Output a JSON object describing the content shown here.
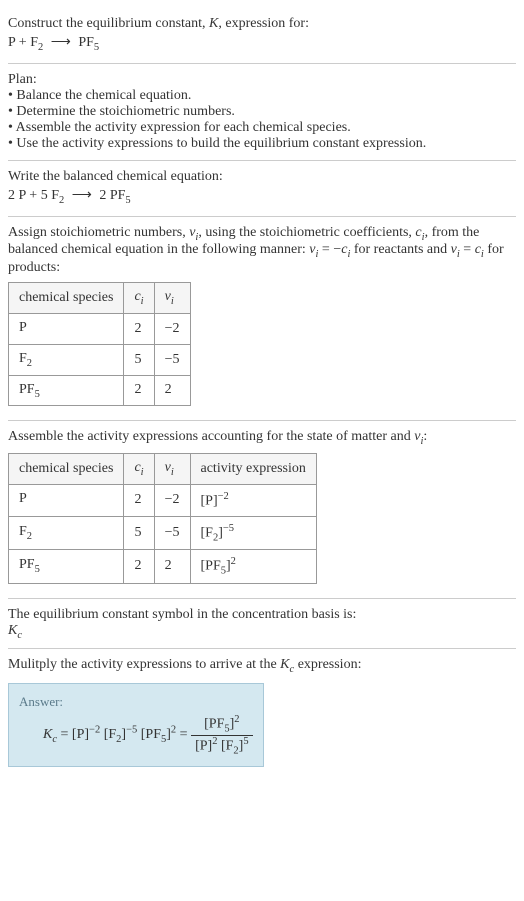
{
  "intro": {
    "line1_pre": "Construct the equilibrium constant, ",
    "line1_k": "K",
    "line1_post": ", expression for:",
    "reaction_lhs_1": "P",
    "reaction_plus": " + ",
    "reaction_lhs_2": "F",
    "reaction_lhs_2_sub": "2",
    "reaction_rhs": "PF",
    "reaction_rhs_sub": "5"
  },
  "plan": {
    "title": "Plan:",
    "b1": "• Balance the chemical equation.",
    "b2": "• Determine the stoichiometric numbers.",
    "b3": "• Assemble the activity expression for each chemical species.",
    "b4": "• Use the activity expressions to build the equilibrium constant expression."
  },
  "balanced": {
    "title": "Write the balanced chemical equation:",
    "c1": "2 P",
    "plus1": " + ",
    "c2": "5 F",
    "c2_sub": "2",
    "c3": "2 PF",
    "c3_sub": "5"
  },
  "stoich": {
    "intro_1": "Assign stoichiometric numbers, ",
    "nu": "ν",
    "nu_sub": "i",
    "intro_2": ", using the stoichiometric coefficients, ",
    "ci": "c",
    "ci_sub": "i",
    "intro_3": ", from the balanced chemical equation in the following manner: ",
    "eq1_l": "ν",
    "eq1_lsub": "i",
    "eq1_mid": " = −",
    "eq1_r": "c",
    "eq1_rsub": "i",
    "intro_4": " for reactants and ",
    "eq2_l": "ν",
    "eq2_lsub": "i",
    "eq2_mid": " = ",
    "eq2_r": "c",
    "eq2_rsub": "i",
    "intro_5": " for products:",
    "headers": [
      "chemical species",
      "cᵢ",
      "νᵢ"
    ],
    "h0": "chemical species",
    "h1": "c",
    "h1_sub": "i",
    "h2": "ν",
    "h2_sub": "i",
    "rows": [
      {
        "sp": "P",
        "sp_sub": "",
        "c": "2",
        "v": "−2"
      },
      {
        "sp": "F",
        "sp_sub": "2",
        "c": "5",
        "v": "−5"
      },
      {
        "sp": "PF",
        "sp_sub": "5",
        "c": "2",
        "v": "2"
      }
    ]
  },
  "activity": {
    "intro_1": "Assemble the activity expressions accounting for the state of matter and ",
    "nu": "ν",
    "nu_sub": "i",
    "intro_2": ":",
    "h0": "chemical species",
    "h1": "c",
    "h1_sub": "i",
    "h2": "ν",
    "h2_sub": "i",
    "h3": "activity expression",
    "rows": [
      {
        "sp": "P",
        "sp_sub": "",
        "c": "2",
        "v": "−2",
        "a_base": "[P]",
        "a_exp": "−2"
      },
      {
        "sp": "F",
        "sp_sub": "2",
        "c": "5",
        "v": "−5",
        "a_base": "[F₂]",
        "a_exp": "−5"
      },
      {
        "sp": "PF",
        "sp_sub": "5",
        "c": "2",
        "v": "2",
        "a_base": "[PF₅]",
        "a_exp": "2"
      }
    ],
    "r0_ab": "[P]",
    "r0_ae": "−2",
    "r1_ab_1": "[F",
    "r1_ab_sub": "2",
    "r1_ab_2": "]",
    "r1_ae": "−5",
    "r2_ab_1": "[PF",
    "r2_ab_sub": "5",
    "r2_ab_2": "]",
    "r2_ae": "2"
  },
  "symbol": {
    "line1": "The equilibrium constant symbol in the concentration basis is:",
    "kc": "K",
    "kc_sub": "c"
  },
  "multiply": {
    "line_1": "Mulitply the activity expressions to arrive at the ",
    "kc": "K",
    "kc_sub": "c",
    "line_2": " expression:"
  },
  "answer": {
    "label": "Answer:",
    "kc": "K",
    "kc_sub": "c",
    "eq": " = ",
    "t1": "[P]",
    "t1_exp": "−2",
    "t2_1": " [F",
    "t2_sub": "2",
    "t2_2": "]",
    "t2_exp": "−5",
    "t3_1": " [PF",
    "t3_sub": "5",
    "t3_2": "]",
    "t3_exp": "2",
    "eq2": " = ",
    "num_1": "[PF",
    "num_sub": "5",
    "num_2": "]",
    "num_exp": "2",
    "den_t1": "[P]",
    "den_t1_exp": "2",
    "den_t2_1": " [F",
    "den_t2_sub": "2",
    "den_t2_2": "]",
    "den_t2_exp": "5"
  }
}
